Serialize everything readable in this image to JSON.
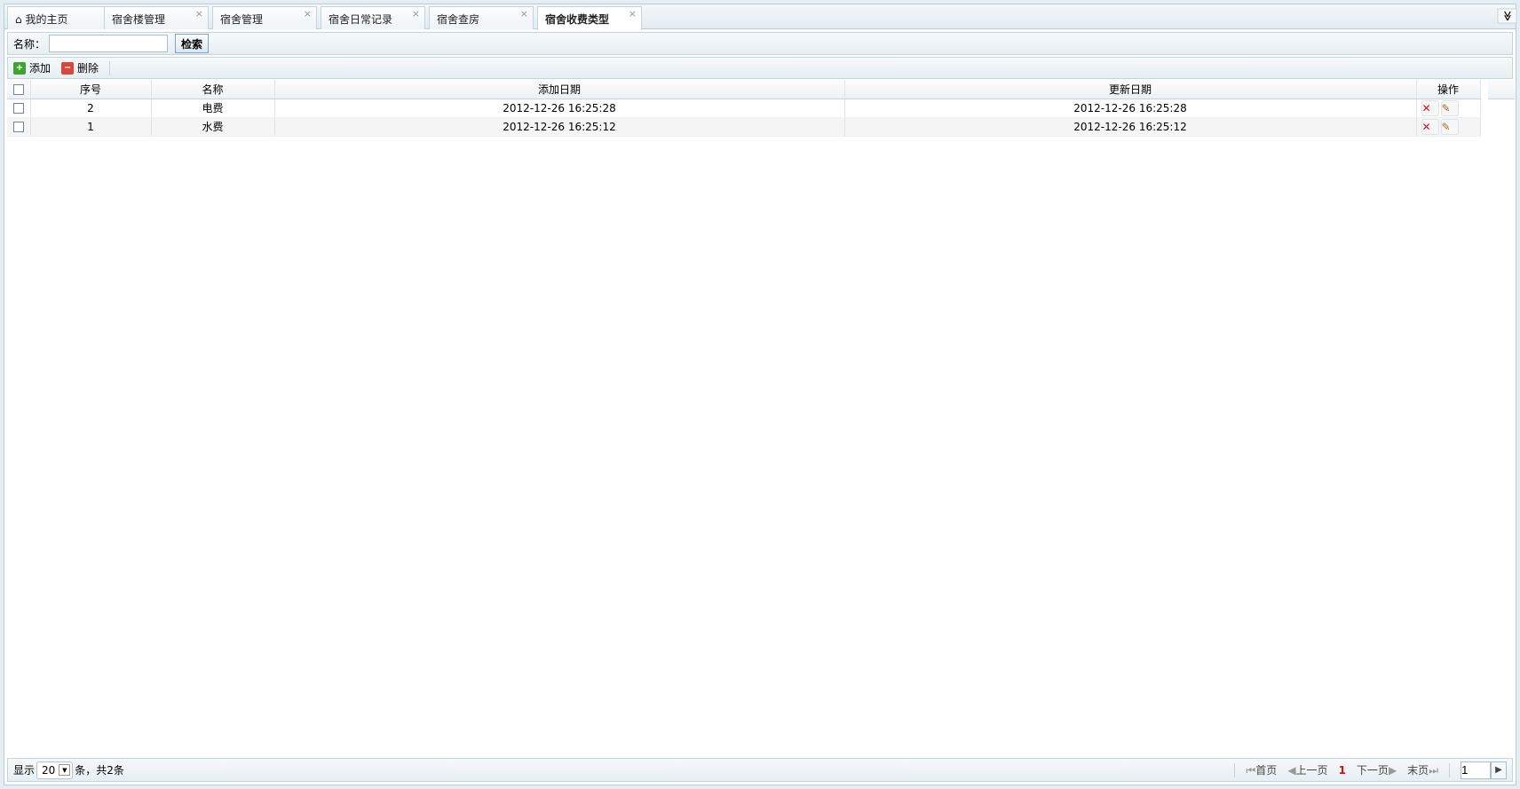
{
  "tabs": [
    {
      "label": "我的主页",
      "icon": "home-icon"
    },
    {
      "label": "宿舍楼管理"
    },
    {
      "label": "宿舍管理"
    },
    {
      "label": "宿舍日常记录"
    },
    {
      "label": "宿舍查房"
    },
    {
      "label": "宿舍收费类型",
      "active": true
    }
  ],
  "tab_close": "×",
  "tab_menu": "≫",
  "search": {
    "label": "名称：",
    "value": "",
    "button": "检索"
  },
  "toolbar": {
    "add": "添加",
    "delete": "删除"
  },
  "table": {
    "headers": [
      "序号",
      "名称",
      "添加日期",
      "更新日期",
      "操作"
    ],
    "rows": [
      {
        "seq": "2",
        "name": "电费",
        "added": "2012-12-26 16:25:28",
        "updated": "2012-12-26 16:25:28"
      },
      {
        "seq": "1",
        "name": "水费",
        "added": "2012-12-26 16:25:12",
        "updated": "2012-12-26 16:25:12"
      }
    ]
  },
  "footer": {
    "show": "显示",
    "page_size": "20",
    "summary": "条，共2条",
    "first": "首页",
    "prev": "上一页",
    "current": "1",
    "next": "下一页",
    "last": "末页",
    "page_input": "1"
  },
  "colors": {
    "accent": "#d0101a",
    "border": "#c3d4de"
  }
}
